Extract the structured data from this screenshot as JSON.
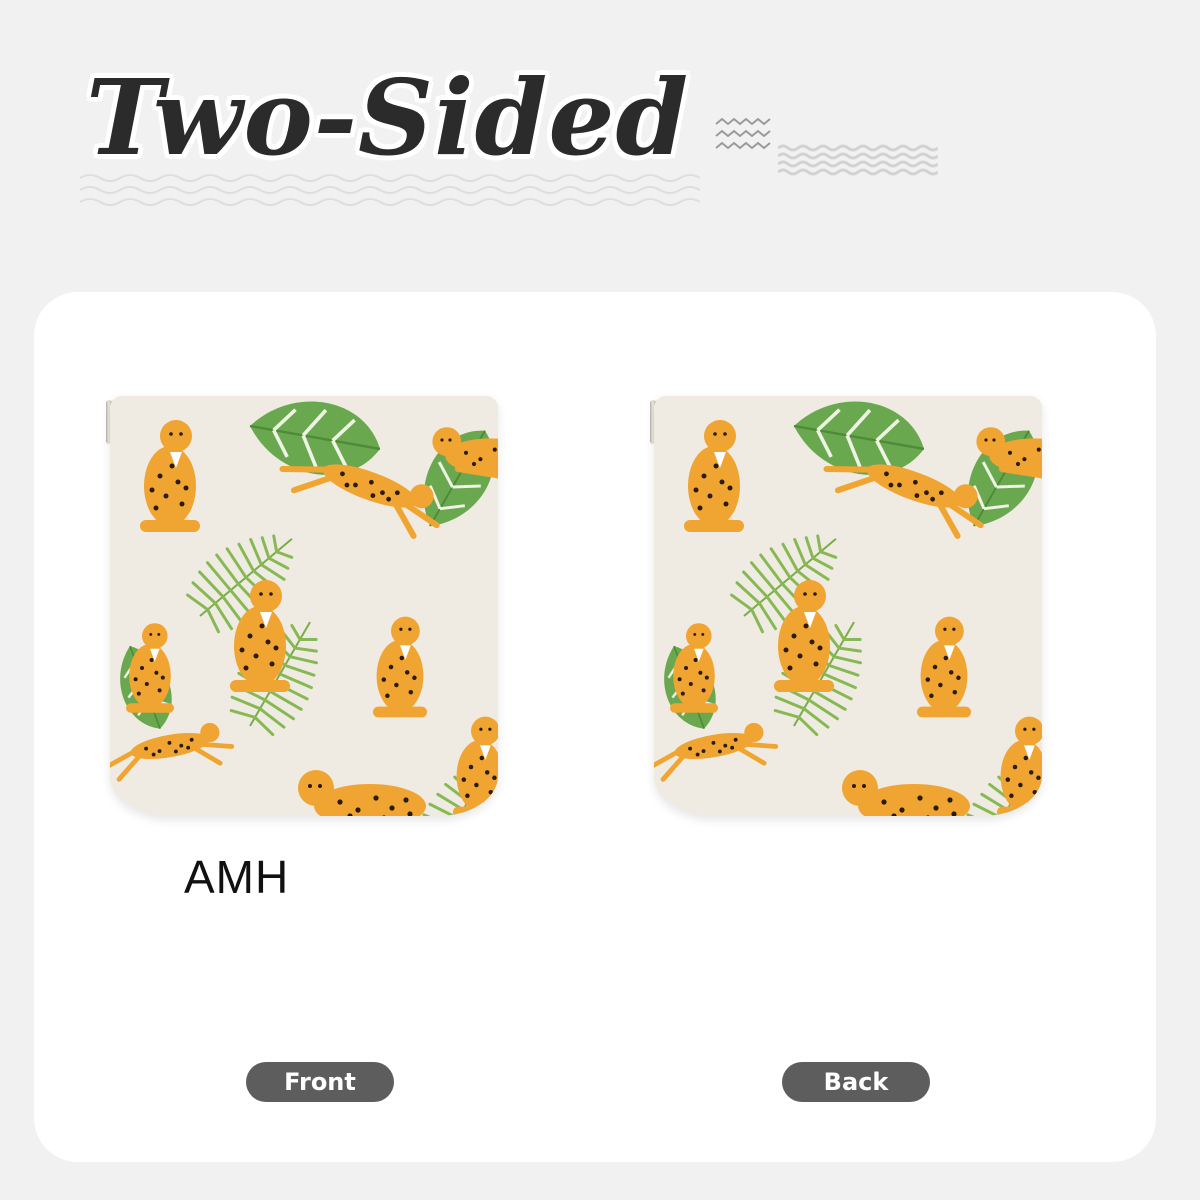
{
  "header": {
    "title": "Two-Sided"
  },
  "panels": [
    {
      "id": "front",
      "label": "Front",
      "monogram": "AMH"
    },
    {
      "id": "back",
      "label": "Back"
    }
  ],
  "colors": {
    "background": "#f1f1f1",
    "card": "#ffffff",
    "pill": "#5d5d5d",
    "fabric": "#f0ebe2",
    "cheetah": "#f0a431",
    "leaf": "#6aa84f"
  }
}
